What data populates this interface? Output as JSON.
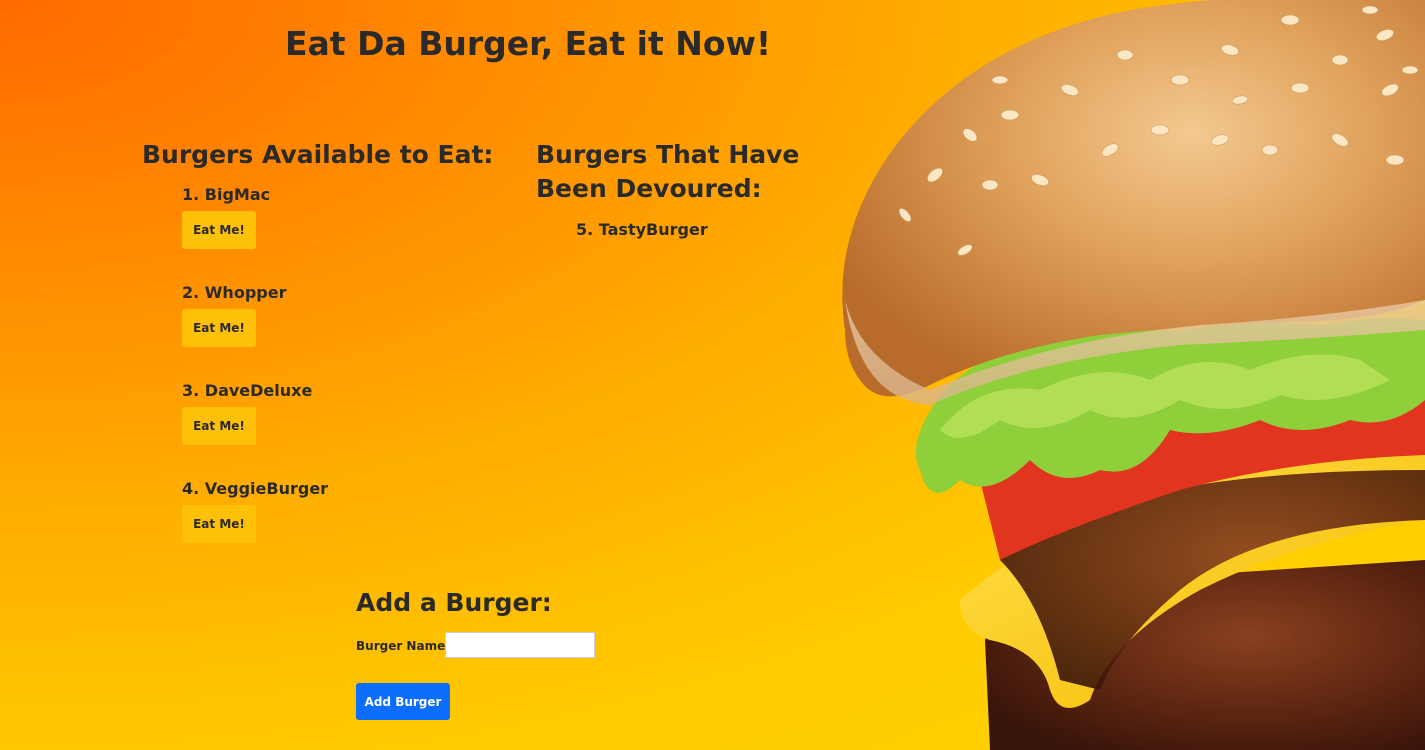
{
  "header": {
    "title": "Eat Da Burger, Eat it Now!"
  },
  "available": {
    "title": "Burgers Available to Eat:",
    "items": [
      {
        "label": "1. BigMac",
        "button": "Eat Me!"
      },
      {
        "label": "2. Whopper",
        "button": "Eat Me!"
      },
      {
        "label": "3. DaveDeluxe",
        "button": "Eat Me!"
      },
      {
        "label": "4. VeggieBurger",
        "button": "Eat Me!"
      }
    ]
  },
  "devoured": {
    "title": "Burgers That Have Been Devoured:",
    "items": [
      {
        "label": "5. TastyBurger"
      }
    ]
  },
  "add_form": {
    "title": "Add a Burger:",
    "name_label": "Burger Name:",
    "name_value": "",
    "submit_label": "Add Burger"
  },
  "colors": {
    "eat_button": "#ffc107",
    "add_button": "#0d6efd",
    "background_orange": "#ff6a00",
    "background_yellow": "#ffd400"
  }
}
